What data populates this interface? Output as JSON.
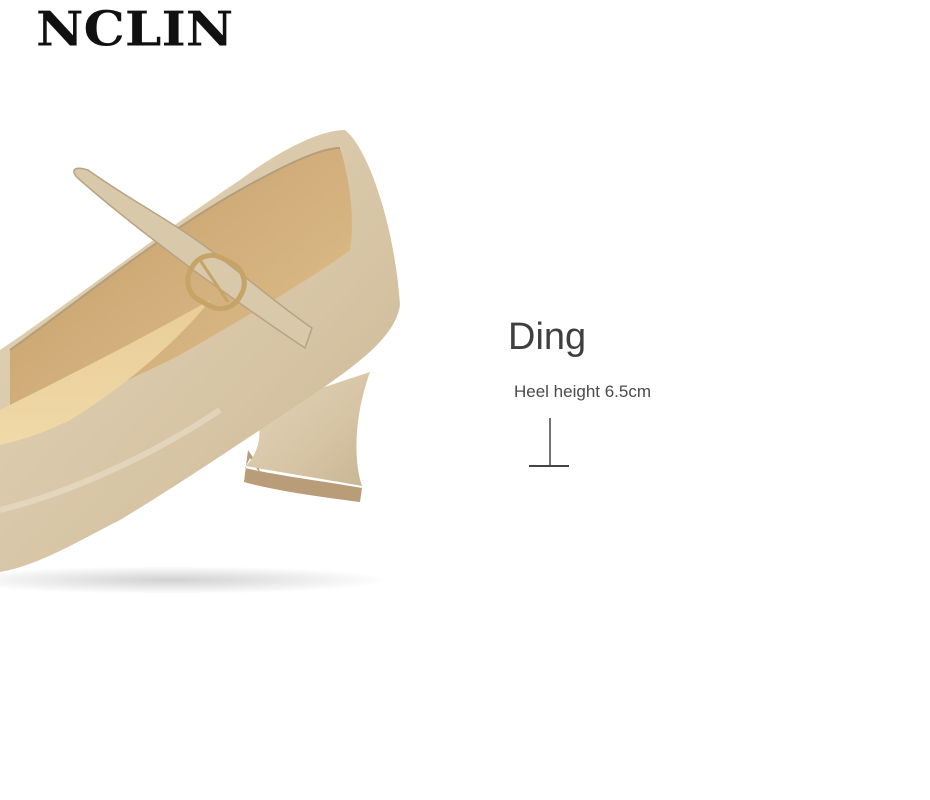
{
  "brand": {
    "name": "NCLIN"
  },
  "product": {
    "title": "Ding",
    "spec_label": "Heel height 6.5cm"
  },
  "icons": {
    "heel": "heel-height-icon"
  },
  "colors": {
    "shoe_leather": "#d8c7a8",
    "lining": "#c9a878",
    "background": "#ffffff",
    "text": "#3f3f3f"
  }
}
